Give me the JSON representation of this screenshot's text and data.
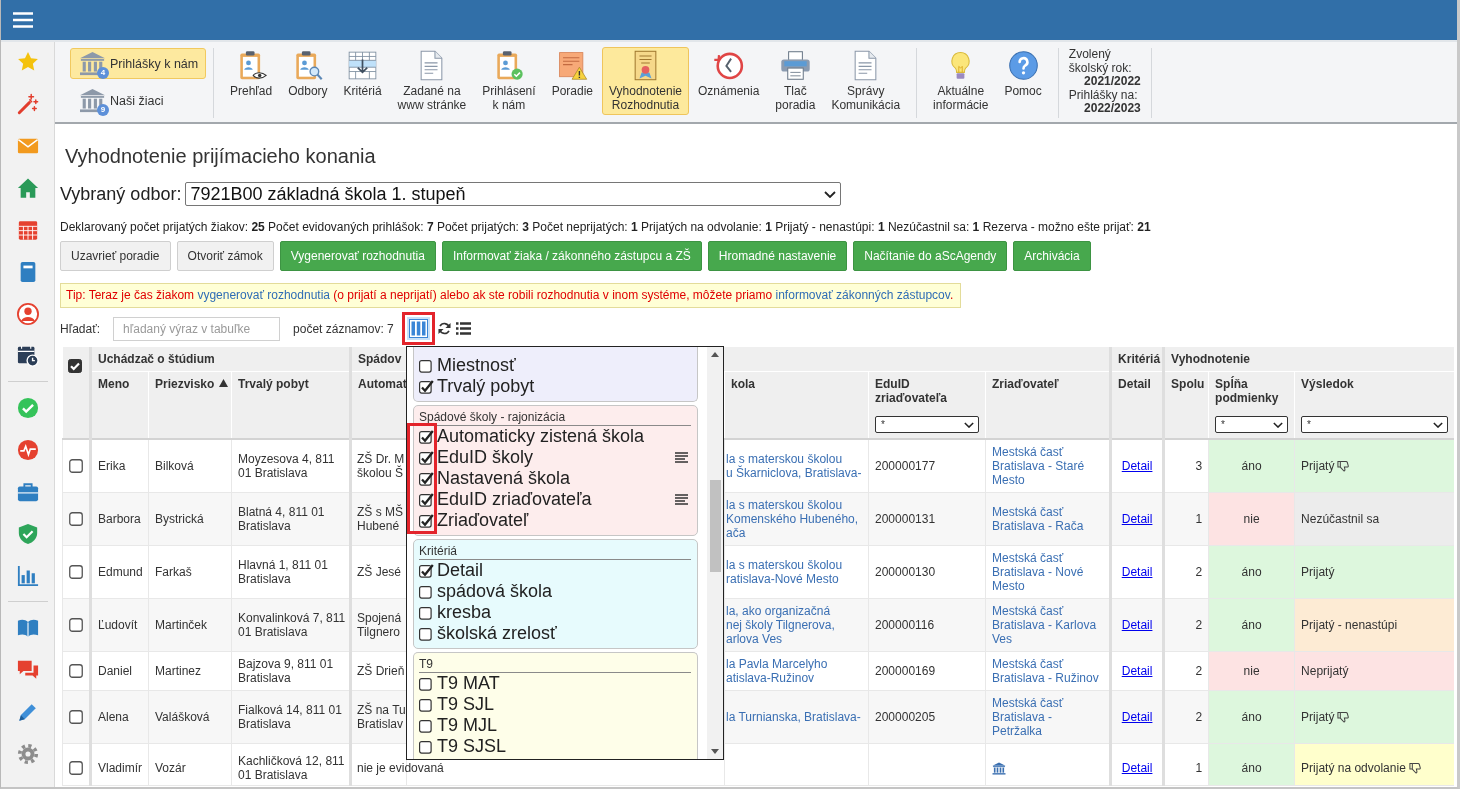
{
  "toolbar": {
    "nav": [
      {
        "label": "Prihlášky k nám",
        "badge": "4",
        "selected": true
      },
      {
        "label": "Naši žiaci",
        "badge": "9",
        "selected": false
      }
    ],
    "tools": [
      {
        "label": "Prehľad",
        "selected": false
      },
      {
        "label": "Odbory",
        "selected": false
      },
      {
        "label": "Kritériá",
        "selected": false
      },
      {
        "label": "Zadané na\nwww stránke",
        "selected": false
      },
      {
        "label": "Prihlásení\nk nám",
        "selected": false
      },
      {
        "label": "Poradie",
        "selected": false
      },
      {
        "label": "Vyhodnotenie\nRozhodnutia",
        "selected": true
      },
      {
        "label": "Oznámenia",
        "selected": false
      },
      {
        "label": "Tlač\nporadia",
        "selected": false
      },
      {
        "label": "Správy\nKomunikácia",
        "selected": false
      }
    ],
    "info": [
      {
        "label": "Aktuálne\ninformácie",
        "selected": false
      },
      {
        "label": "Pomoc",
        "selected": false
      }
    ],
    "year": {
      "school_year_label": "Zvolený školský rok:",
      "school_year": "2021/2022",
      "applications_label": "Prihlášky na:",
      "applications_year": "2022/2023"
    }
  },
  "page": {
    "title": "Vyhodnotenie prijímacieho konania",
    "field": {
      "label": "Vybraný odbor:",
      "value": "7921B00 základná škola 1. stupeň"
    },
    "summary": "Deklarovaný počet prijatých žiakov: **25** Počet evidovaných prihlášok: **7** Počet prijatých: **3** Počet neprijatých: **1** Prijatých na odvolanie: **1** Prijatý - nenastúpi: **1** Nezúčastnil sa: **1** Rezerva - možno ešte prijať: **21**",
    "actions": [
      {
        "label": "Uzavrieť poradie",
        "kind": "plain"
      },
      {
        "label": "Otvoriť zámok",
        "kind": "plain"
      },
      {
        "label": "Vygenerovať rozhodnutia",
        "kind": "success"
      },
      {
        "label": "Informovať žiaka / zákonného zástupcu a ZŠ",
        "kind": "success"
      },
      {
        "label": "Hromadné nastavenie",
        "kind": "success"
      },
      {
        "label": "Načítanie do aScAgendy",
        "kind": "success"
      },
      {
        "label": "Archivácia",
        "kind": "success"
      }
    ],
    "tip": [
      {
        "kind": "text",
        "text": "Tip: Teraz je čas žiakom "
      },
      {
        "kind": "link",
        "text": "vygenerovať rozhodnutia"
      },
      {
        "kind": "text",
        "text": " (o prijatí a neprijatí) alebo ak ste robili rozhodnutia v inom systéme, môžete priamo "
      },
      {
        "kind": "link",
        "text": "informovať zákonných zástupcov"
      },
      {
        "kind": "text",
        "text": "."
      }
    ],
    "search": {
      "label": "Hľadať:",
      "placeholder": "hľadaný výraz v tabuľke"
    },
    "record_count": "počet záznamov: 7",
    "column_chooser": {
      "open": true,
      "highlighted": true,
      "groups": [
        {
          "color": "#eeeefb",
          "highlighted": false,
          "items": [
            {
              "label": "Miestnosť",
              "checked": false,
              "lines_icon": false
            },
            {
              "label": "Trvalý pobyt",
              "checked": true,
              "lines_icon": false
            }
          ]
        },
        {
          "title": "Spádové školy - rajonizácia",
          "color": "#fdeded",
          "highlighted": true,
          "items": [
            {
              "label": "Automaticky zistená škola",
              "checked": true,
              "lines_icon": false
            },
            {
              "label": "EduID školy",
              "checked": true,
              "lines_icon": true
            },
            {
              "label": "Nastavená škola",
              "checked": true,
              "lines_icon": false
            },
            {
              "label": "EduID zriaďovateľa",
              "checked": true,
              "lines_icon": true
            },
            {
              "label": "Zriaďovateľ",
              "checked": true,
              "lines_icon": false
            }
          ]
        },
        {
          "title": "Kritériá",
          "color": "#e7fbfd",
          "highlighted": false,
          "items": [
            {
              "label": "Detail",
              "checked": true,
              "lines_icon": false
            },
            {
              "label": "spádová škola",
              "checked": false,
              "lines_icon": false
            },
            {
              "label": "kresba",
              "checked": false,
              "lines_icon": false
            },
            {
              "label": "školská zrelosť",
              "checked": false,
              "lines_icon": false
            }
          ]
        },
        {
          "title": "T9",
          "color": "#fefee9",
          "highlighted": false,
          "items": [
            {
              "label": "T9 MAT",
              "checked": false,
              "lines_icon": false
            },
            {
              "label": "T9 SJL",
              "checked": false,
              "lines_icon": false
            },
            {
              "label": "T9 MJL",
              "checked": false,
              "lines_icon": false
            },
            {
              "label": "T9 SJSL",
              "checked": false,
              "lines_icon": false
            }
          ]
        }
      ]
    }
  },
  "table": {
    "select_all": {
      "checked": true
    },
    "groups": [
      {
        "label": "Uchádzač o štúdium",
        "columns": [
          {
            "label": "Meno"
          },
          {
            "label": "Priezvisko",
            "sort_ascending": true
          },
          {
            "label": "Trvalý pobyt"
          }
        ]
      },
      {
        "label": "Spádov",
        "columns": [
          {
            "label": "Automat"
          },
          {
            "label": "kola"
          },
          {
            "label": "EduID zriaďovateľa",
            "filter": "*"
          },
          {
            "label": "Zriaďovateľ"
          }
        ]
      },
      {
        "label": "Kritériá",
        "columns": [
          {
            "label": "Detail"
          }
        ]
      },
      {
        "label": "Vyhodnotenie",
        "columns": [
          {
            "label": "Spolu"
          },
          {
            "label": "Spĺňa podmienky",
            "filter": "*"
          },
          {
            "label": "Výsledok",
            "filter": "*"
          }
        ]
      }
    ],
    "rows": [
      {
        "checked": false,
        "meno": "Erika",
        "priezvisko": "Bilková",
        "trvaly_pobyt": "Moyzesova 4, 811 01 Bratislava",
        "column_4": "ZŠ Dr. M\nškolou Š",
        "column_5": "la s materskou školou\nu Škarniclova, Bratislava-",
        "eduid_zriadovatela": "200000177",
        "zriadovatel": "Mestská časť Bratislava - Staré Mesto",
        "zriadovatel_icon": false,
        "detail": "Detail",
        "spolu": "3",
        "splna_podmienky": {
          "text": "áno",
          "met": true
        },
        "vysledok": {
          "text": "Prijatý",
          "color": "#ddf7dd",
          "thumb": true
        }
      },
      {
        "checked": false,
        "meno": "Barbora",
        "priezvisko": "Bystrická",
        "trvaly_pobyt": "Blatná 4, 811 01 Bratislava",
        "column_4": "ZŠ s MŠ\nHubené",
        "column_5": "la s materskou školou\nKomenského Hubeného,\nača",
        "eduid_zriadovatela": "200000131",
        "zriadovatel": "Mestská časť Bratislava - Rača",
        "zriadovatel_icon": false,
        "detail": "Detail",
        "spolu": "1",
        "splna_podmienky": {
          "text": "nie",
          "met": false
        },
        "vysledok": {
          "text": "Nezúčastnil sa",
          "color": "#ececec",
          "thumb": false
        }
      },
      {
        "checked": false,
        "meno": "Edmund",
        "priezvisko": "Farkaš",
        "trvaly_pobyt": "Hlavná 1, 811 01 Bratislava",
        "column_4": "ZŠ Jesé",
        "column_5": "la s materskou školou\nratislava-Nové Mesto",
        "eduid_zriadovatela": "200000130",
        "zriadovatel": "Mestská časť Bratislava - Nové Mesto",
        "zriadovatel_icon": false,
        "detail": "Detail",
        "spolu": "2",
        "splna_podmienky": {
          "text": "áno",
          "met": true
        },
        "vysledok": {
          "text": "Prijatý",
          "color": "#ddf7dd",
          "thumb": false
        }
      },
      {
        "checked": false,
        "meno": "Ľudovít",
        "priezvisko": "Martinček",
        "trvaly_pobyt": "Konvalinková 7, 811 01 Bratislava",
        "column_4": "Spojená\nTilgnero",
        "column_5": "la, ako organizačná\nnej školy Tilgnerova,\narlova Ves",
        "eduid_zriadovatela": "200000116",
        "zriadovatel": "Mestská časť Bratislava - Karlova Ves",
        "zriadovatel_icon": false,
        "detail": "Detail",
        "spolu": "2",
        "splna_podmienky": {
          "text": "áno",
          "met": true
        },
        "vysledok": {
          "text": "Prijatý - nenastúpi",
          "color": "#fdebd4",
          "thumb": false
        }
      },
      {
        "checked": false,
        "meno": "Daniel",
        "priezvisko": "Martinez",
        "trvaly_pobyt": "Bajzova 9, 811 01 Bratislava",
        "column_4": "ZŠ Drieň",
        "column_5": "la Pavla Marcelyho\natislava-Ružinov",
        "eduid_zriadovatela": "200000169",
        "zriadovatel": "Mestská časť Bratislava - Ružinov",
        "zriadovatel_icon": false,
        "detail": "Detail",
        "spolu": "2",
        "splna_podmienky": {
          "text": "nie",
          "met": false
        },
        "vysledok": {
          "text": "Neprijatý",
          "color": "#fde3e3",
          "thumb": false
        }
      },
      {
        "checked": false,
        "meno": "Alena",
        "priezvisko": "Valášková",
        "trvaly_pobyt": "Fialková 14, 811 01 Bratislava",
        "column_4": "ZŠ na Tu\nBratislav",
        "column_5": "la Turnianska, Bratislava-",
        "eduid_zriadovatela": "200000205",
        "zriadovatel": "Mestská časť Bratislava - Petržalka",
        "zriadovatel_icon": false,
        "detail": "Detail",
        "spolu": "2",
        "splna_podmienky": {
          "text": "áno",
          "met": true
        },
        "vysledok": {
          "text": "Prijatý",
          "color": "#ddf7dd",
          "thumb": true
        }
      },
      {
        "checked": false,
        "meno": "Vladimír",
        "priezvisko": "Vozár",
        "trvaly_pobyt": "Kachličková 12, 811 01 Bratislava",
        "column_4": "nie je evidovaná",
        "zriadovatel_icon": true,
        "detail": "Detail",
        "spolu": "1",
        "splna_podmienky": {
          "text": "áno",
          "met": true
        },
        "vysledok": {
          "text": "Prijatý na odvolanie",
          "color": "#ffffcc",
          "thumb": true
        }
      }
    ]
  }
}
